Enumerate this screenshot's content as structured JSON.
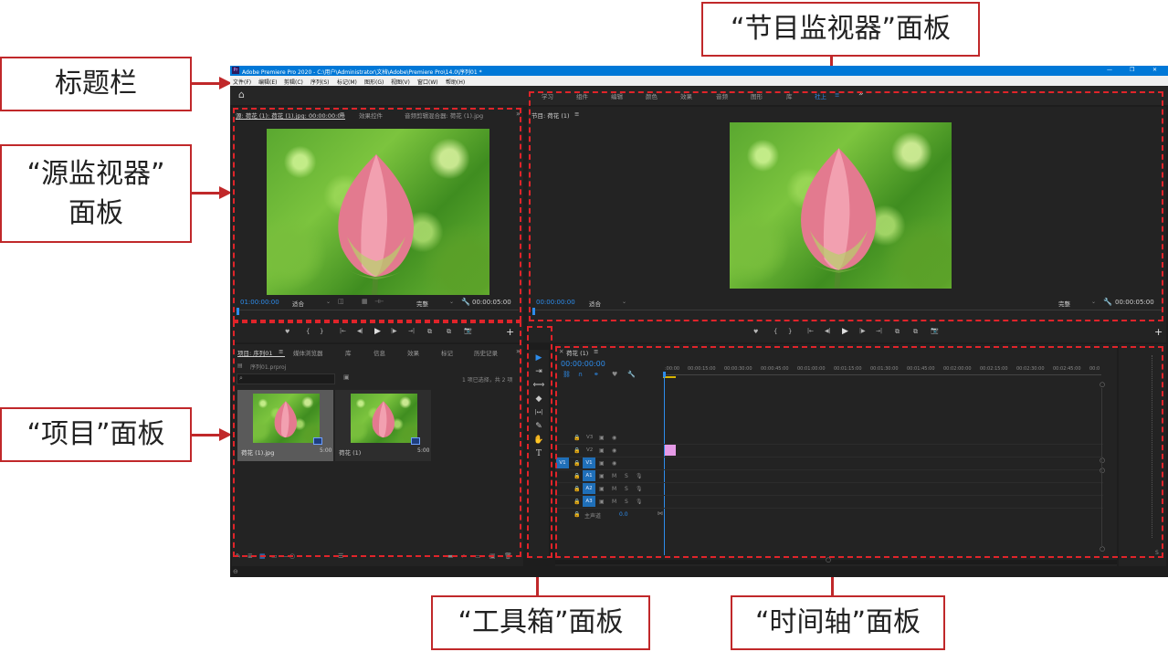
{
  "callouts": {
    "title_bar": "标题栏",
    "program_monitor": "“节目监视器”面板",
    "source_monitor_l1": "“源监视器”",
    "source_monitor_l2": "面板",
    "project": "“项目”面板",
    "toolbox": "“工具箱”面板",
    "timeline": "“时间轴”面板",
    "accent_color": "#c0282a"
  },
  "app": {
    "title": "Adobe Premiere Pro 2020 - C:\\用户\\Administrator\\文档\\Adobe\\Premiere Pro\\14.0\\序列01 *",
    "title_bar_color": "#0078d7",
    "window_buttons": [
      "—",
      "❐",
      "✕"
    ],
    "menu": [
      "文件(F)",
      "编辑(E)",
      "剪辑(C)",
      "序列(S)",
      "标记(M)",
      "图形(G)",
      "视图(V)",
      "窗口(W)",
      "帮助(H)"
    ],
    "workspaces": [
      "学习",
      "组件",
      "编辑",
      "颜色",
      "效果",
      "音频",
      "图形",
      "库",
      "社上"
    ],
    "workspace_menu_icon": "≡",
    "overflow": "»"
  },
  "source_monitor": {
    "tabs": [
      "源: 荷花 (1): 荷花 (1).jpg: 00:00:00:00",
      "效果控件",
      "音频剪辑混合器: 荷花 (1).jpg"
    ],
    "menu_icon": "≡",
    "overflow": "»",
    "timecode": "01:00:00:00",
    "fit": "适合",
    "quality": "完整",
    "duration": "00:00:05:00"
  },
  "program_monitor": {
    "tab": "节目: 荷花 (1)",
    "menu_icon": "≡",
    "timecode": "00:00:00:00",
    "fit": "适合",
    "quality": "完整",
    "duration": "00:00:05:00"
  },
  "transport_glyphs": [
    "♥",
    "{",
    "}",
    "|←",
    "◀|",
    "▶",
    "|▶",
    "→|",
    "⧉",
    "⧉",
    "📷"
  ],
  "project_panel": {
    "tabs": [
      "项目: 序列01",
      "媒体浏览器",
      "库",
      "信息",
      "效果",
      "标记",
      "历史记录"
    ],
    "menu_icon": "≡",
    "overflow": "»",
    "project_file": "序列01.prproj",
    "search_placeholder": "",
    "selection_info": "1 项已选择，共 2 项",
    "items": [
      {
        "name": "荷花 (1).jpg",
        "duration": "5:00"
      },
      {
        "name": "荷花 (1)",
        "duration": "5:00"
      }
    ]
  },
  "timeline": {
    "tab": "荷花 (1)",
    "menu_icon": "≡",
    "timecode": "00:00:00:00",
    "ruler": [
      ":00:00",
      "00:00:15:00",
      "00:00:30:00",
      "00:00:45:00",
      "00:01:00:00",
      "00:01:15:00",
      "00:01:30:00",
      "00:01:45:00",
      "00:02:00:00",
      "00:02:15:00",
      "00:02:30:00",
      "00:02:45:00",
      "00:0"
    ],
    "video_tracks": [
      "V3",
      "V2",
      "V1"
    ],
    "audio_tracks": [
      "A1",
      "A2",
      "A3"
    ],
    "source_patch_video": "V1",
    "track_M": "M",
    "track_S": "S",
    "master_label": "主声道",
    "master_value": "0.0",
    "clip_color": "#e59ae6"
  },
  "tools": [
    "▶",
    "⇥",
    "⟺",
    "◆",
    "|↔|",
    "✎",
    "✋",
    "T"
  ]
}
